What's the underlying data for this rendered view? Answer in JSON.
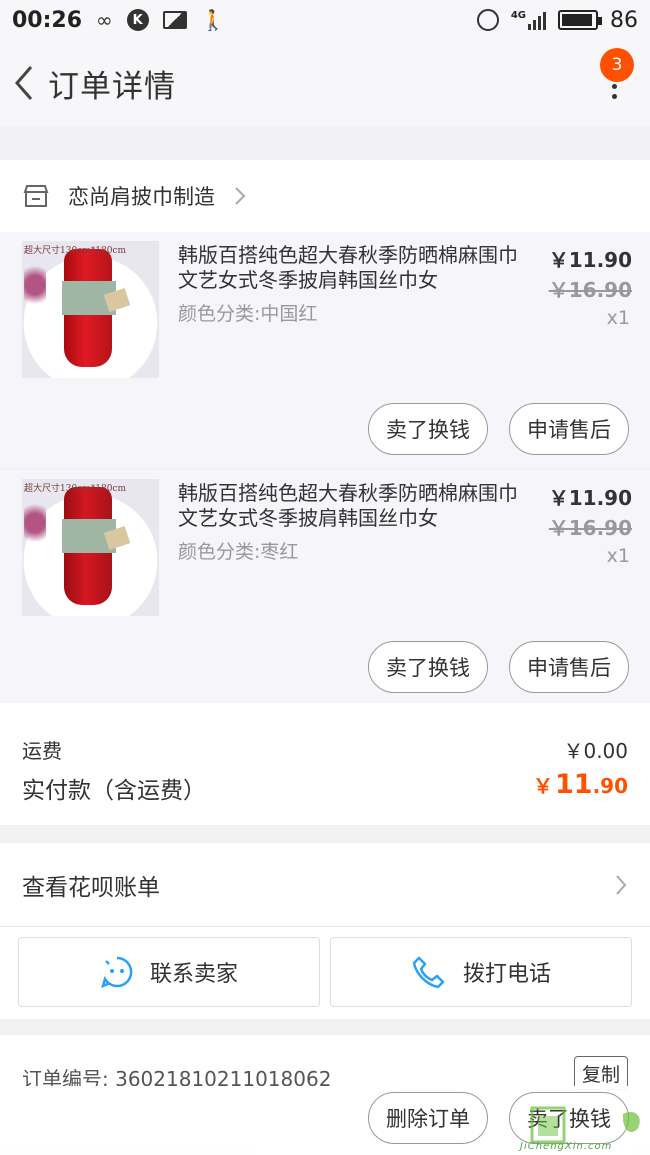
{
  "status_bar": {
    "time": "00:26",
    "network": "4G",
    "battery": "86"
  },
  "nav": {
    "title": "订单详情",
    "badge": "3"
  },
  "shop": {
    "name": "恋尚肩披巾制造"
  },
  "items": [
    {
      "image_caption": "超大尺寸130cm*180cm",
      "title": "韩版百搭纯色超大春秋季防晒棉麻围巾文艺女式冬季披肩韩国丝巾女",
      "spec": "颜色分类:中国红",
      "price": "￥11.90",
      "original_price": "￥16.90",
      "quantity": "x1",
      "buttons": [
        "卖了换钱",
        "申请售后"
      ]
    },
    {
      "image_caption": "超大尺寸130cm*180cm",
      "title": "韩版百搭纯色超大春秋季防晒棉麻围巾文艺女式冬季披肩韩国丝巾女",
      "spec": "颜色分类:枣红",
      "price": "￥11.90",
      "original_price": "￥16.90",
      "quantity": "x1",
      "buttons": [
        "卖了换钱",
        "申请售后"
      ]
    }
  ],
  "summary": {
    "shipping_label": "运费",
    "shipping_value": "￥0.00",
    "paid_label": "实付款（含运费）",
    "paid_currency": "￥",
    "paid_integer": "11",
    "paid_decimal": ".90"
  },
  "huabei": {
    "label": "查看花呗账单"
  },
  "contact": {
    "seller_label": "联系卖家",
    "phone_label": "拨打电话"
  },
  "order": {
    "number_label": "订单编号: 3602181021101806​2",
    "copy_label": "复制"
  },
  "bottom_bar": {
    "delete_label": "删除订单",
    "sell_label": "卖了换钱"
  },
  "watermark": {
    "text": "JiChengXin.com"
  },
  "colors": {
    "accent": "#ff5000",
    "icon_blue": "#29a1f7"
  }
}
